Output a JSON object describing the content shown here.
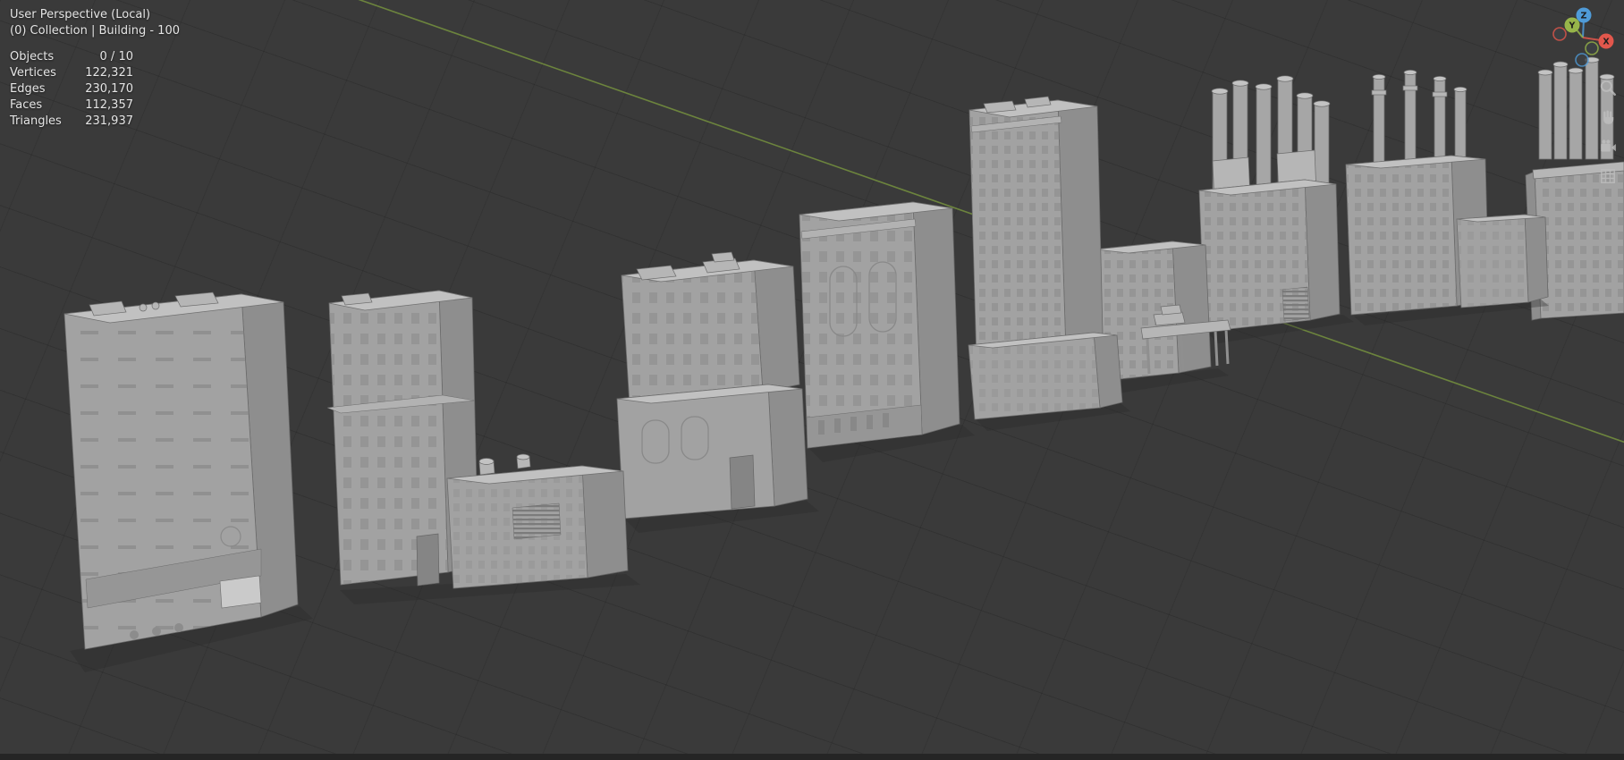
{
  "viewport": {
    "header": {
      "line1": "User Perspective (Local)",
      "line2": "(0) Collection | Building - 100"
    },
    "stats": {
      "rows": [
        {
          "label": "Objects",
          "value": "0 / 10"
        },
        {
          "label": "Vertices",
          "value": "122,321"
        },
        {
          "label": "Edges",
          "value": "230,170"
        },
        {
          "label": "Faces",
          "value": "112,357"
        },
        {
          "label": "Triangles",
          "value": "231,937"
        }
      ]
    }
  },
  "gizmo": {
    "axes": {
      "x": "X",
      "y": "Y",
      "z": "Z"
    }
  },
  "side_toolbar": {
    "icons": [
      "zoom-icon",
      "pan-hand-icon",
      "camera-view-icon",
      "orthographic-grid-icon"
    ]
  },
  "colors": {
    "viewport_background": "#3a3a3a",
    "grid_line": "#2e2e2e",
    "axis_y_green": "#75913e",
    "building_front": "#a2a2a2",
    "building_side": "#8e8e8e",
    "building_roof": "#c1c1c1",
    "gizmo_x": "#e2574c",
    "gizmo_y": "#97b54a",
    "gizmo_z": "#4f9bd8",
    "overlay_text": "#e5e5e5"
  }
}
